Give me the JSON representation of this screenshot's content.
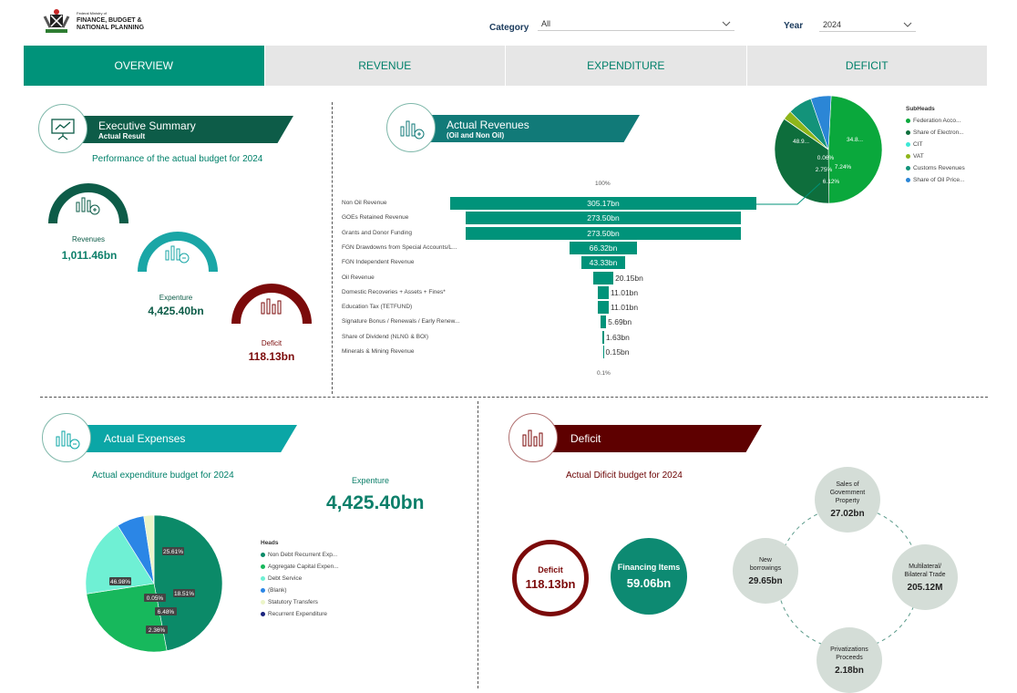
{
  "header": {
    "logo_small": "Federal Ministry of",
    "logo_line1": "FINANCE, BUDGET &",
    "logo_line2": "NATIONAL PLANNING",
    "category_label": "Category",
    "category_value": "All",
    "year_label": "Year",
    "year_value": "2024"
  },
  "tabs": [
    {
      "label": "OVERVIEW",
      "active": true
    },
    {
      "label": "REVENUE",
      "active": false
    },
    {
      "label": "EXPENDITURE",
      "active": false
    },
    {
      "label": "DEFICIT",
      "active": false
    }
  ],
  "exec": {
    "title": "Executive Summary",
    "subtitle": "Actual Result",
    "caption": "Performance of the actual budget for  2024",
    "revenues_label": "Revenues",
    "revenues_value": "1,011.46bn",
    "expenture_label": "Expenture",
    "expenture_value": "4,425.40bn",
    "deficit_label": "Deficit",
    "deficit_value": "118.13bn"
  },
  "revenues": {
    "title": "Actual Revenues",
    "subtitle": "(Oil and Non Oil)",
    "top_pct": "100%",
    "bottom_pct": "0.1%",
    "legend_title": "SubHeads"
  },
  "expenses": {
    "title": "Actual Expenses",
    "caption": "Actual expenditure budget for  2024",
    "kpi_label": "Expenture",
    "kpi_value": "4,425.40bn",
    "legend_title": "Heads"
  },
  "deficit": {
    "title": "Deficit",
    "caption": "Actual Dificit budget for  2024",
    "deficit_label": "Deficit",
    "deficit_value": "118.13bn",
    "financing_label": "Financing Items",
    "financing_value": "59.06bn",
    "bubbles": [
      {
        "label": "Sales of Government Property",
        "value": "27.02bn"
      },
      {
        "label": "Multilateral/ Bilateral Trade",
        "value": "205.12M"
      },
      {
        "label": "Privatizations Proceeds",
        "value": "2.18bn"
      },
      {
        "label": "New borrowings",
        "value": "29.65bn"
      }
    ]
  },
  "chart_data": [
    {
      "type": "bar",
      "subtype": "funnel",
      "categories": [
        "Non Oil Revenue",
        "GOEs Retained Revenue",
        "Grants and Donor Funding",
        "FGN Drawdowns from Special Accounts/L...",
        "FGN Independent Revenue",
        "Oil Revenue",
        "Domestic Recoveries + Assets + Fines*",
        "Education Tax (TETFUND)",
        "Signature Bonus / Renewals / Early Renew...",
        "Share of Dividend (NLNG & BOI)",
        "Minerals & Mining Revenue"
      ],
      "values": [
        305.17,
        273.5,
        273.5,
        66.32,
        43.33,
        20.15,
        11.01,
        11.01,
        5.69,
        1.63,
        0.15
      ],
      "labels": [
        "305.17bn",
        "273.50bn",
        "273.50bn",
        "66.32bn",
        "43.33bn",
        "20.15bn",
        "11.01bn",
        "11.01bn",
        "5.69bn",
        "1.63bn",
        "0.15bn"
      ],
      "color": "#00937a"
    },
    {
      "type": "pie",
      "legend_title": "SubHeads",
      "categories": [
        "Federation Acco...",
        "Share of Electron...",
        "CIT",
        "VAT",
        "Customs Revenues",
        "Share of Oil Price..."
      ],
      "values": [
        48.9,
        34.8,
        0.06,
        2.75,
        7.24,
        6.12
      ],
      "labels": [
        "48.9...",
        "34.8...",
        "0.06%",
        "2.75%",
        "7.24%",
        "6.12%"
      ],
      "colors": [
        "#0aa83c",
        "#0e6e3c",
        "#3de8d6",
        "#8eb51a",
        "#13937a",
        "#2b86d6"
      ],
      "legend_position": "right"
    },
    {
      "type": "pie",
      "legend_title": "Heads",
      "categories": [
        "Non Debt Recurrent Exp...",
        "Aggregate Capital Expen...",
        "Debt Service",
        "(Blank)",
        "Statutory Transfers",
        "Recurrent Expenditure"
      ],
      "values": [
        46.98,
        25.61,
        18.51,
        6.48,
        2.36,
        0.05
      ],
      "labels": [
        "46.98%",
        "25.61%",
        "18.51%",
        "6.48%",
        "2.36%",
        "0.05%"
      ],
      "colors": [
        "#0b8a68",
        "#17b85c",
        "#6ff0d4",
        "#2b86e6",
        "#ecf5c8",
        "#1a237e"
      ],
      "legend_position": "right"
    }
  ]
}
